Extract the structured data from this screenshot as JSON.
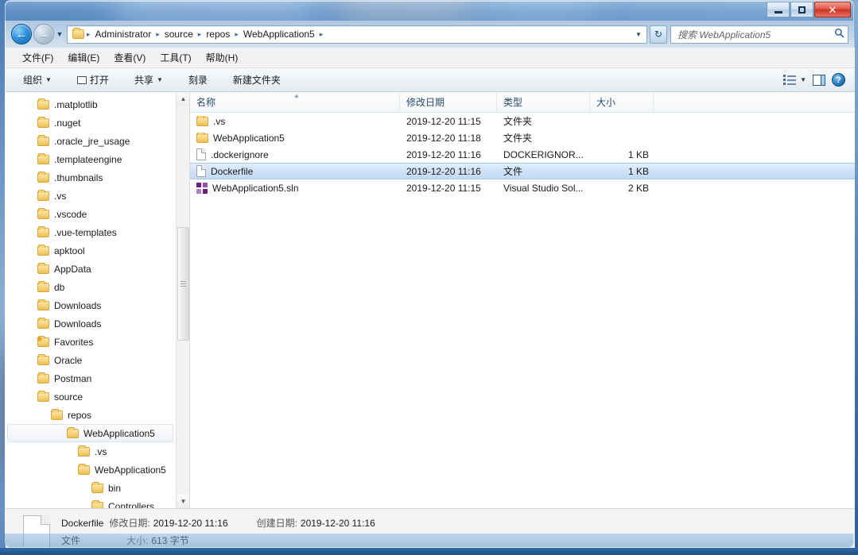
{
  "window": {
    "controls": {
      "minimize": "minimize-button",
      "maximize": "maximize-button",
      "close": "close-button",
      "close_glyph": "✕"
    }
  },
  "address": {
    "back_glyph": "←",
    "forward_glyph": "→",
    "history_caret": "▼",
    "dropdown_caret": "▼",
    "refresh_glyph": "↻",
    "crumbs": [
      "Administrator",
      "source",
      "repos",
      "WebApplication5"
    ],
    "separator": "▸"
  },
  "search": {
    "placeholder": "搜索 WebApplication5",
    "icon_glyph": "⚲"
  },
  "menubar": {
    "items": [
      {
        "label": "文件(F)"
      },
      {
        "label": "编辑(E)"
      },
      {
        "label": "查看(V)"
      },
      {
        "label": "工具(T)"
      },
      {
        "label": "帮助(H)"
      }
    ]
  },
  "toolbar": {
    "organize": "组织",
    "open": "打开",
    "share": "共享",
    "burn": "刻录",
    "new_folder": "新建文件夹",
    "caret": "▼",
    "help_glyph": "?"
  },
  "sidebar": {
    "items": [
      {
        "label": ".matplotlib",
        "indent": 0,
        "icon": "folder-icon",
        "selected": false
      },
      {
        "label": ".nuget",
        "indent": 0,
        "icon": "folder-icon",
        "selected": false
      },
      {
        "label": ".oracle_jre_usage",
        "indent": 0,
        "icon": "folder-icon",
        "selected": false
      },
      {
        "label": ".templateengine",
        "indent": 0,
        "icon": "folder-icon",
        "selected": false
      },
      {
        "label": ".thumbnails",
        "indent": 0,
        "icon": "folder-icon",
        "selected": false
      },
      {
        "label": ".vs",
        "indent": 0,
        "icon": "folder-icon",
        "selected": false
      },
      {
        "label": ".vscode",
        "indent": 0,
        "icon": "folder-icon",
        "selected": false
      },
      {
        "label": ".vue-templates",
        "indent": 0,
        "icon": "folder-icon",
        "selected": false
      },
      {
        "label": "apktool",
        "indent": 0,
        "icon": "folder-icon",
        "selected": false
      },
      {
        "label": "AppData",
        "indent": 0,
        "icon": "folder-icon",
        "selected": false
      },
      {
        "label": "db",
        "indent": 0,
        "icon": "folder-icon",
        "selected": false
      },
      {
        "label": "Downloads",
        "indent": 0,
        "icon": "folder-icon",
        "selected": false
      },
      {
        "label": "Downloads",
        "indent": 0,
        "icon": "folder-icon",
        "selected": false
      },
      {
        "label": "Favorites",
        "indent": 0,
        "icon": "folder-star-icon",
        "selected": false
      },
      {
        "label": "Oracle",
        "indent": 0,
        "icon": "folder-icon",
        "selected": false
      },
      {
        "label": "Postman",
        "indent": 0,
        "icon": "folder-icon",
        "selected": false
      },
      {
        "label": "source",
        "indent": 0,
        "icon": "folder-icon",
        "selected": false
      },
      {
        "label": "repos",
        "indent": 1,
        "icon": "folder-icon",
        "selected": false
      },
      {
        "label": "WebApplication5",
        "indent": 2,
        "icon": "folder-icon",
        "selected": true
      },
      {
        "label": ".vs",
        "indent": 3,
        "icon": "folder-icon",
        "selected": false
      },
      {
        "label": "WebApplication5",
        "indent": 3,
        "icon": "folder-icon",
        "selected": false
      },
      {
        "label": "bin",
        "indent": 4,
        "icon": "folder-icon",
        "selected": false
      },
      {
        "label": "Controllers",
        "indent": 4,
        "icon": "folder-icon",
        "selected": false
      }
    ],
    "scrollbar": {
      "up_glyph": "▲",
      "down_glyph": "▼"
    }
  },
  "filelist": {
    "columns": [
      {
        "key": "name",
        "label": "名称"
      },
      {
        "key": "date",
        "label": "修改日期"
      },
      {
        "key": "type",
        "label": "类型"
      },
      {
        "key": "size",
        "label": "大小"
      }
    ],
    "sort_glyph": "▲",
    "rows": [
      {
        "name": ".vs",
        "date": "2019-12-20 11:15",
        "type": "文件夹",
        "size": "",
        "icon": "folder-icon",
        "selected": false
      },
      {
        "name": "WebApplication5",
        "date": "2019-12-20 11:18",
        "type": "文件夹",
        "size": "",
        "icon": "folder-icon",
        "selected": false
      },
      {
        "name": ".dockerignore",
        "date": "2019-12-20 11:16",
        "type": "DOCKERIGNOR...",
        "size": "1 KB",
        "icon": "file-icon",
        "selected": false
      },
      {
        "name": "Dockerfile",
        "date": "2019-12-20 11:16",
        "type": "文件",
        "size": "1 KB",
        "icon": "file-icon",
        "selected": true
      },
      {
        "name": "WebApplication5.sln",
        "date": "2019-12-20 11:15",
        "type": "Visual Studio Sol...",
        "size": "2 KB",
        "icon": "visual-studio-solution-icon",
        "selected": false
      }
    ]
  },
  "statusbar": {
    "name": "Dockerfile",
    "modified_label": "修改日期:",
    "modified_value": "2019-12-20 11:16",
    "created_label": "创建日期:",
    "created_value": "2019-12-20 11:16",
    "type": "文件",
    "size_label": "大小:",
    "size_value": "613 字节"
  },
  "colors": {
    "selection": "#cfe2f7",
    "selection_border": "#a8ccec",
    "folder": "#f6d278",
    "header_text": "#2a4a6a",
    "close_button": "#cc3526"
  }
}
